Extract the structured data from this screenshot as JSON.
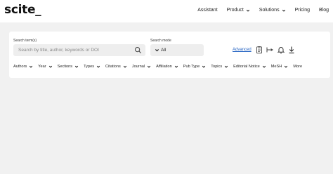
{
  "brand": {
    "logo": "scite_"
  },
  "nav": {
    "items": [
      {
        "label": "Assistant",
        "has_dropdown": false
      },
      {
        "label": "Product",
        "has_dropdown": true
      },
      {
        "label": "Solutions",
        "has_dropdown": true
      },
      {
        "label": "Pricing",
        "has_dropdown": false
      },
      {
        "label": "Blog",
        "has_dropdown": false
      }
    ]
  },
  "search": {
    "terms_label": "Search term(s)",
    "placeholder": "Search by title, author, keywords or DOI",
    "mode_label": "Search mode",
    "mode_value": "All",
    "advanced_label": "Advanced"
  },
  "toolbar": {
    "icons": [
      "clipboard-icon",
      "flow-icon",
      "bell-icon",
      "download-icon"
    ]
  },
  "filters": [
    "Authors",
    "Year",
    "Sections",
    "Types",
    "Citations",
    "Journal",
    "Affiliation",
    "Pub Type",
    "Topics",
    "Editorial Notice",
    "MeSH",
    "More"
  ],
  "colors": {
    "background": "#f1f1f1",
    "card": "#ffffff",
    "link": "#2463c2"
  }
}
